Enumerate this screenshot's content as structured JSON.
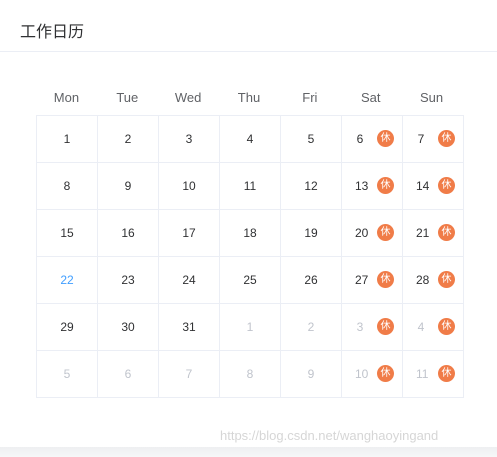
{
  "card": {
    "title": "工作日历"
  },
  "weekdays": [
    "Mon",
    "Tue",
    "Wed",
    "Thu",
    "Fri",
    "Sat",
    "Sun"
  ],
  "rest_badge": "休",
  "weeks": [
    [
      {
        "d": "1"
      },
      {
        "d": "2"
      },
      {
        "d": "3"
      },
      {
        "d": "4"
      },
      {
        "d": "5"
      },
      {
        "d": "6",
        "rest": true
      },
      {
        "d": "7",
        "rest": true
      }
    ],
    [
      {
        "d": "8"
      },
      {
        "d": "9"
      },
      {
        "d": "10"
      },
      {
        "d": "11"
      },
      {
        "d": "12"
      },
      {
        "d": "13",
        "rest": true
      },
      {
        "d": "14",
        "rest": true
      }
    ],
    [
      {
        "d": "15"
      },
      {
        "d": "16"
      },
      {
        "d": "17"
      },
      {
        "d": "18"
      },
      {
        "d": "19"
      },
      {
        "d": "20",
        "rest": true
      },
      {
        "d": "21",
        "rest": true
      }
    ],
    [
      {
        "d": "22",
        "today": true
      },
      {
        "d": "23"
      },
      {
        "d": "24"
      },
      {
        "d": "25"
      },
      {
        "d": "26"
      },
      {
        "d": "27",
        "rest": true
      },
      {
        "d": "28",
        "rest": true
      }
    ],
    [
      {
        "d": "29"
      },
      {
        "d": "30"
      },
      {
        "d": "31"
      },
      {
        "d": "1",
        "other": true
      },
      {
        "d": "2",
        "other": true
      },
      {
        "d": "3",
        "other": true,
        "rest": true
      },
      {
        "d": "4",
        "other": true,
        "rest": true
      }
    ],
    [
      {
        "d": "5",
        "other": true
      },
      {
        "d": "6",
        "other": true
      },
      {
        "d": "7",
        "other": true
      },
      {
        "d": "8",
        "other": true
      },
      {
        "d": "9",
        "other": true
      },
      {
        "d": "10",
        "other": true,
        "rest": true
      },
      {
        "d": "11",
        "other": true,
        "rest": true
      }
    ]
  ],
  "colors": {
    "rest_badge": "#f07c48",
    "today": "#409eff",
    "other_month": "#c0c4cc"
  },
  "watermark": "https://blog.csdn.net/wanghaoyingand"
}
